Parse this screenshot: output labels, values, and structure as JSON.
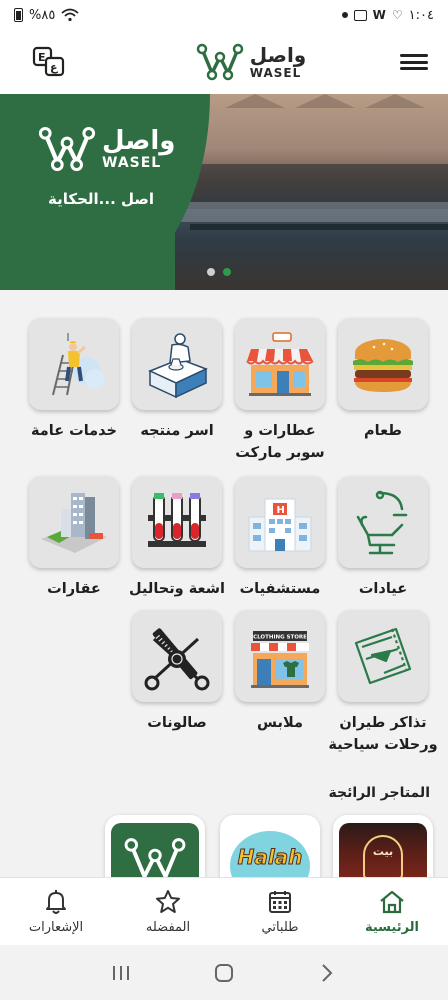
{
  "status_bar": {
    "battery": "%٨٥",
    "time": "١:٠٤"
  },
  "header": {
    "logo_ar": "واصل",
    "logo_en": "WASEL",
    "menu_icon": "hamburger-icon",
    "language_icon": "translate-icon"
  },
  "banner": {
    "logo_ar": "واصل",
    "logo_en": "WASEL",
    "slogan": "اصل ...الحكاية",
    "slide_count": 2,
    "active_slide": 2
  },
  "categories": [
    {
      "label": "طعام",
      "icon": "burger-icon"
    },
    {
      "label": "عطارات و سوبر ماركت",
      "icon": "storefront-icon"
    },
    {
      "label": "اسر منتجه",
      "icon": "artisan-icon"
    },
    {
      "label": "خدمات عامة",
      "icon": "worker-ladder-icon"
    },
    {
      "label": "عيادات",
      "icon": "dental-chair-icon"
    },
    {
      "label": "مستشفيات",
      "icon": "hospital-icon"
    },
    {
      "label": "اشعة وتحاليل",
      "icon": "test-tubes-icon"
    },
    {
      "label": "عقارات",
      "icon": "buildings-icon"
    },
    {
      "label": "تذاكر طيران ورحلات سياحية",
      "icon": "flight-ticket-icon"
    },
    {
      "label": "ملابس",
      "icon": "clothing-store-icon"
    },
    {
      "label": "صالونات",
      "icon": "salon-icon"
    }
  ],
  "clothing_store_sign": "CLOTHING STORE",
  "trending": {
    "title": "المتاجر الرائجة",
    "stores": [
      {
        "name": "restaurant-store",
        "text": "بيت"
      },
      {
        "name": "halah-store",
        "text": "Halah"
      },
      {
        "name": "wasel-store",
        "text": ""
      }
    ]
  },
  "bottom_nav": [
    {
      "label": "الرئيسية",
      "icon": "home-icon",
      "active": true
    },
    {
      "label": "طلباتي",
      "icon": "calendar-icon",
      "active": false
    },
    {
      "label": "المفضله",
      "icon": "star-icon",
      "active": false
    },
    {
      "label": "الإشعارات",
      "icon": "bell-icon",
      "active": false
    }
  ],
  "colors": {
    "brand_green": "#2f6e42",
    "active_dot": "#2e9a4a",
    "nav_active": "#2b6b3e"
  }
}
